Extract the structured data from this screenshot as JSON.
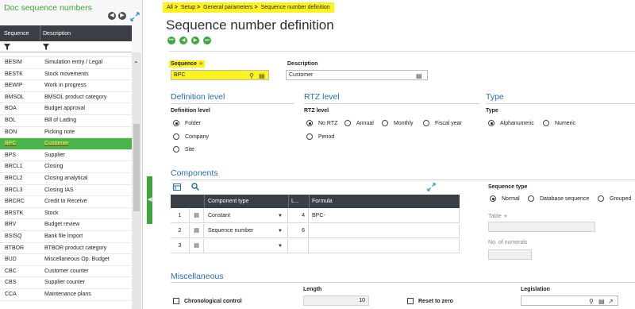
{
  "left_panel": {
    "title": "Doc sequence numbers",
    "col_sequence": "Sequence",
    "col_description": "Description",
    "rows": [
      {
        "code": "BESIM",
        "desc": "Simulation entry / Legal"
      },
      {
        "code": "BESTK",
        "desc": "Stock movements"
      },
      {
        "code": "BEWIP",
        "desc": "Work in progress"
      },
      {
        "code": "BMSOL",
        "desc": "BMSOL product category"
      },
      {
        "code": "BOA",
        "desc": "Budget approval"
      },
      {
        "code": "BOL",
        "desc": "Bill of Lading"
      },
      {
        "code": "BON",
        "desc": "Picking note"
      },
      {
        "code": "BPC",
        "desc": "Customer"
      },
      {
        "code": "BPS",
        "desc": "Supplier"
      },
      {
        "code": "BRCL1",
        "desc": "Closing"
      },
      {
        "code": "BRCL2",
        "desc": "Closing analytical"
      },
      {
        "code": "BRCL3",
        "desc": "Closing IAS"
      },
      {
        "code": "BRCRC",
        "desc": "Credit to Receive"
      },
      {
        "code": "BRSTK",
        "desc": "Stock"
      },
      {
        "code": "BRV",
        "desc": "Budget review"
      },
      {
        "code": "BSISQ",
        "desc": "Bank file import"
      },
      {
        "code": "BTBOR",
        "desc": "BTBOR product category"
      },
      {
        "code": "BUD",
        "desc": "Miscellaneous Op. Budget"
      },
      {
        "code": "CBC",
        "desc": "Customer counter"
      },
      {
        "code": "CBS",
        "desc": "Supplier counter"
      },
      {
        "code": "CCA",
        "desc": "Maintenance plans"
      }
    ],
    "selected_index": 7
  },
  "breadcrumb": [
    "All",
    "Setup",
    "General parameters",
    "Sequence number definition"
  ],
  "page_title": "Sequence number definition",
  "header": {
    "sequence_label": "Sequence",
    "sequence_value": "BPC",
    "description_label": "Description",
    "description_value": "Customer"
  },
  "definition_level": {
    "title": "Definition level",
    "label": "Definition level",
    "options": [
      "Folder",
      "Company",
      "Site"
    ],
    "selected": "Folder"
  },
  "rtz_level": {
    "title": "RTZ level",
    "label": "RTZ level",
    "options": [
      "No RTZ",
      "Annual",
      "Monthly",
      "Fiscal year",
      "Period"
    ],
    "selected": "No RTZ"
  },
  "type": {
    "title": "Type",
    "label": "Type",
    "options": [
      "Alphanumeric",
      "Numeric"
    ],
    "selected": "Alphanumeric"
  },
  "components": {
    "title": "Components",
    "columns": [
      "Component type",
      "L...",
      "Formula"
    ],
    "rows": [
      {
        "num": "1",
        "type": "Constant",
        "length": "4",
        "formula": "BPC-"
      },
      {
        "num": "2",
        "type": "Sequence number",
        "length": "6",
        "formula": ""
      },
      {
        "num": "3",
        "type": "",
        "length": "",
        "formula": ""
      }
    ]
  },
  "sequence_type": {
    "label": "Sequence type",
    "options": [
      "Normal",
      "Database sequence",
      "Grouped"
    ],
    "selected": "Normal",
    "table_label": "Table",
    "numerals_label": "No. of numerals"
  },
  "misc": {
    "title": "Miscellaneous",
    "chronological_label": "Chronological control",
    "length_label": "Length",
    "length_value": "10",
    "reset_label": "Reset to zero",
    "legislation_label": "Legislation"
  }
}
